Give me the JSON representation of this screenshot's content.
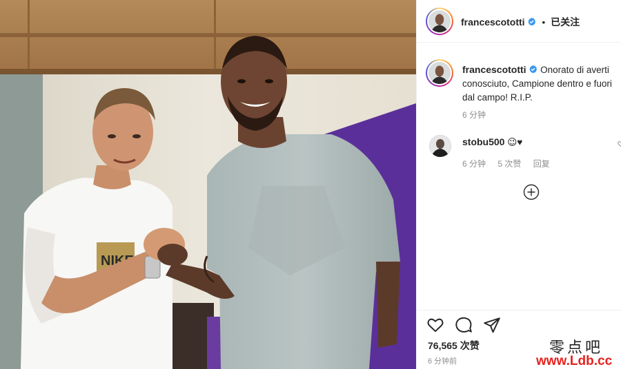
{
  "header": {
    "username": "francescototti",
    "separator": "•",
    "follow_label": "已关注"
  },
  "caption": {
    "username": "francescototti",
    "text": "Onorato di averti conosciuto, Campione dentro e fuori dal campo! R.I.P.",
    "time": "6 分钟"
  },
  "comments": [
    {
      "username": "stobu500",
      "text": "😉♥",
      "time": "6 分钟",
      "likes": "5 次赞",
      "reply_label": "回复"
    }
  ],
  "actions": {
    "likes": "76,565 次赞",
    "posted": "6 分钟前"
  },
  "photo": {
    "shirt_print": "NIKE"
  },
  "watermark": {
    "line1": "零点吧",
    "line2": "www.Ldb.cc"
  },
  "colors": {
    "text": "#262626",
    "secondary": "#8e8e8e",
    "verified": "#3897f0",
    "watermark_red": "#e8211d"
  },
  "icons": [
    "verified-badge-icon",
    "heart-icon",
    "comment-icon",
    "share-icon",
    "add-comment-icon"
  ]
}
